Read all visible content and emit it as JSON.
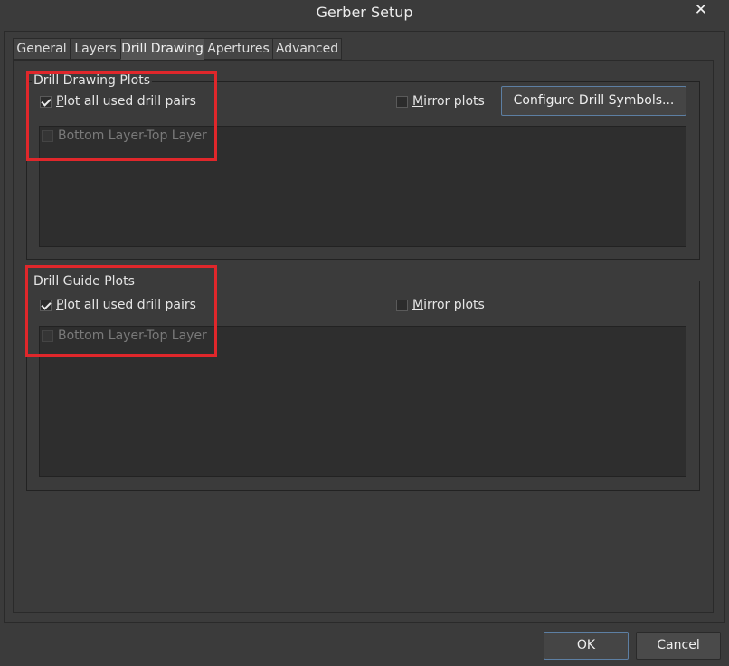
{
  "window": {
    "title": "Gerber Setup",
    "close_glyph": "✕"
  },
  "tabs": [
    {
      "label": "General"
    },
    {
      "label": "Layers"
    },
    {
      "label": "Drill Drawing",
      "active": true
    },
    {
      "label": "Apertures"
    },
    {
      "label": "Advanced"
    }
  ],
  "drill_drawing": {
    "title": "Drill Drawing Plots",
    "plot_all": {
      "prefix": "P",
      "rest": "lot all used drill pairs",
      "checked": true
    },
    "mirror": {
      "prefix": "M",
      "rest": "irror plots",
      "checked": false
    },
    "configure_button": "Configure Drill Symbols...",
    "layer_pair": {
      "label": "Bottom Layer-Top Layer",
      "checked": false,
      "disabled": true
    }
  },
  "drill_guide": {
    "title": "Drill Guide Plots",
    "plot_all": {
      "prefix": "P",
      "rest": "lot all used drill pairs",
      "checked": true
    },
    "mirror": {
      "prefix": "M",
      "rest": "irror plots",
      "checked": false
    },
    "layer_pair": {
      "label": "Bottom Layer-Top Layer",
      "checked": false,
      "disabled": true
    }
  },
  "footer": {
    "ok": "OK",
    "cancel": "Cancel"
  },
  "colors": {
    "highlight": "#e0272b",
    "background": "#3b3b3b",
    "focus_border": "#5d7fa3"
  }
}
